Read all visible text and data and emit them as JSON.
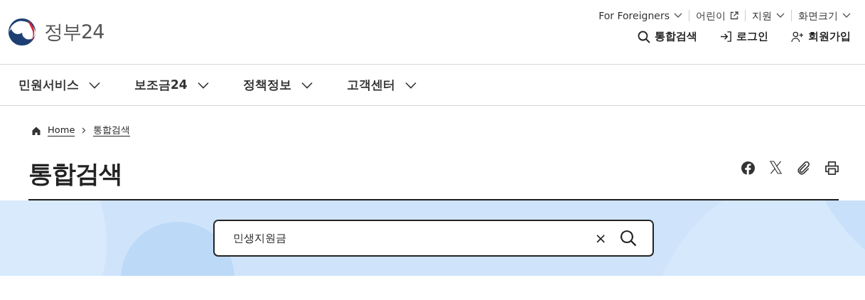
{
  "header": {
    "logo_text": "정부24",
    "utility_links": [
      {
        "label": "For Foreigners",
        "kind": "dropdown"
      },
      {
        "label": "어린이",
        "kind": "external"
      },
      {
        "label": "지원",
        "kind": "dropdown"
      },
      {
        "label": "화면크기",
        "kind": "dropdown"
      }
    ],
    "actions": [
      {
        "label": "통합검색",
        "kind": "search"
      },
      {
        "label": "로그인",
        "kind": "login"
      },
      {
        "label": "회원가입",
        "kind": "signup"
      }
    ]
  },
  "nav": {
    "items": [
      {
        "label": "민원서비스"
      },
      {
        "label": "보조금24"
      },
      {
        "label": "정책정보"
      },
      {
        "label": "고객센터"
      }
    ]
  },
  "breadcrumb": [
    {
      "label": "Home",
      "kind": "home"
    },
    {
      "label": "통합검색",
      "kind": "page"
    }
  ],
  "page_title": "통합검색",
  "share_buttons": [
    {
      "kind": "facebook"
    },
    {
      "kind": "x"
    },
    {
      "kind": "link"
    },
    {
      "kind": "print"
    }
  ],
  "search": {
    "value": "민생지원금",
    "clear_label": "×"
  }
}
